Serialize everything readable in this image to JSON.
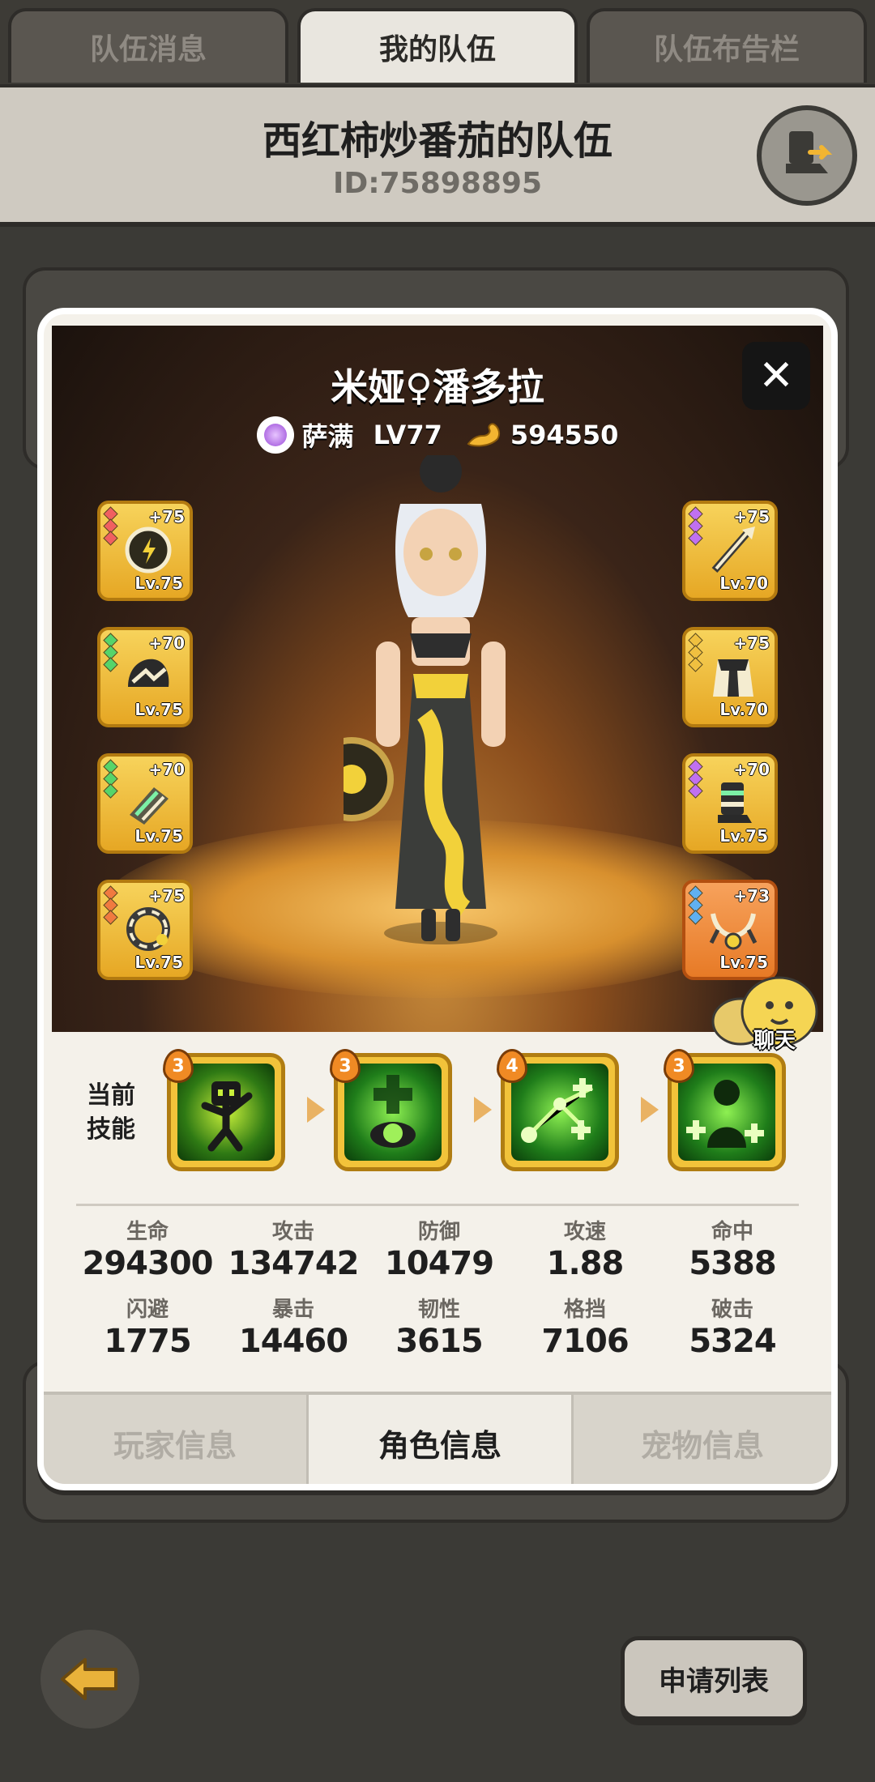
{
  "top_tabs": [
    {
      "label": "队伍消息",
      "active": false
    },
    {
      "label": "我的队伍",
      "active": true
    },
    {
      "label": "队伍布告栏",
      "active": false
    }
  ],
  "team": {
    "title": "西红柿炒番茄的队伍",
    "id": "ID:75898895"
  },
  "character": {
    "name": "米娅♀潘多拉",
    "class": "萨满",
    "level": "LV77",
    "power": "594550",
    "close_label": "✕"
  },
  "equipment_left": [
    {
      "plus": "+75",
      "level": "Lv.75",
      "pips": [
        "#f06060",
        "#f06060",
        "#f06060"
      ],
      "icon": "shield-icon"
    },
    {
      "plus": "+70",
      "level": "Lv.75",
      "pips": [
        "#56d46a",
        "#56d46a",
        "#56d46a"
      ],
      "icon": "helmet-icon"
    },
    {
      "plus": "+70",
      "level": "Lv.75",
      "pips": [
        "#56d46a",
        "#56d46a",
        "#56d46a"
      ],
      "icon": "gloves-icon"
    },
    {
      "plus": "+75",
      "level": "Lv.75",
      "pips": [
        "#f07a40",
        "#f07a40",
        "#f07a40"
      ],
      "icon": "ring-icon"
    }
  ],
  "equipment_right": [
    {
      "plus": "+75",
      "level": "Lv.70",
      "pips": [
        "#c070f0",
        "#c070f0",
        "#c070f0"
      ],
      "icon": "staff-icon"
    },
    {
      "plus": "+75",
      "level": "Lv.70",
      "pips": [
        "#f0c040",
        "#f0c040",
        "#f0c040"
      ],
      "icon": "armor-icon"
    },
    {
      "plus": "+70",
      "level": "Lv.75",
      "pips": [
        "#c070f0",
        "#c070f0",
        "#c070f0"
      ],
      "icon": "boots-icon"
    },
    {
      "plus": "+73",
      "level": "Lv.75",
      "pips": [
        "#60b0f0",
        "#60b0f0",
        "#60b0f0"
      ],
      "icon": "necklace-icon",
      "quality": "orange"
    }
  ],
  "chat_label": "聊天",
  "skills": {
    "label_line1": "当前",
    "label_line2": "技能",
    "items": [
      {
        "level": "3",
        "icon": "dancing-figure-icon"
      },
      {
        "level": "3",
        "icon": "healing-totem-icon"
      },
      {
        "level": "4",
        "icon": "heal-chain-icon"
      },
      {
        "level": "3",
        "icon": "group-heal-icon"
      }
    ]
  },
  "stats": [
    {
      "label": "生命",
      "value": "294300"
    },
    {
      "label": "攻击",
      "value": "134742"
    },
    {
      "label": "防御",
      "value": "10479"
    },
    {
      "label": "攻速",
      "value": "1.88"
    },
    {
      "label": "命中",
      "value": "5388"
    },
    {
      "label": "闪避",
      "value": "1775"
    },
    {
      "label": "暴击",
      "value": "14460"
    },
    {
      "label": "韧性",
      "value": "3615"
    },
    {
      "label": "格挡",
      "value": "7106"
    },
    {
      "label": "破击",
      "value": "5324"
    }
  ],
  "bottom_tabs": [
    {
      "label": "玩家信息",
      "active": false
    },
    {
      "label": "角色信息",
      "active": true
    },
    {
      "label": "宠物信息",
      "active": false
    }
  ],
  "footer": {
    "apply_list_label": "申请列表"
  }
}
